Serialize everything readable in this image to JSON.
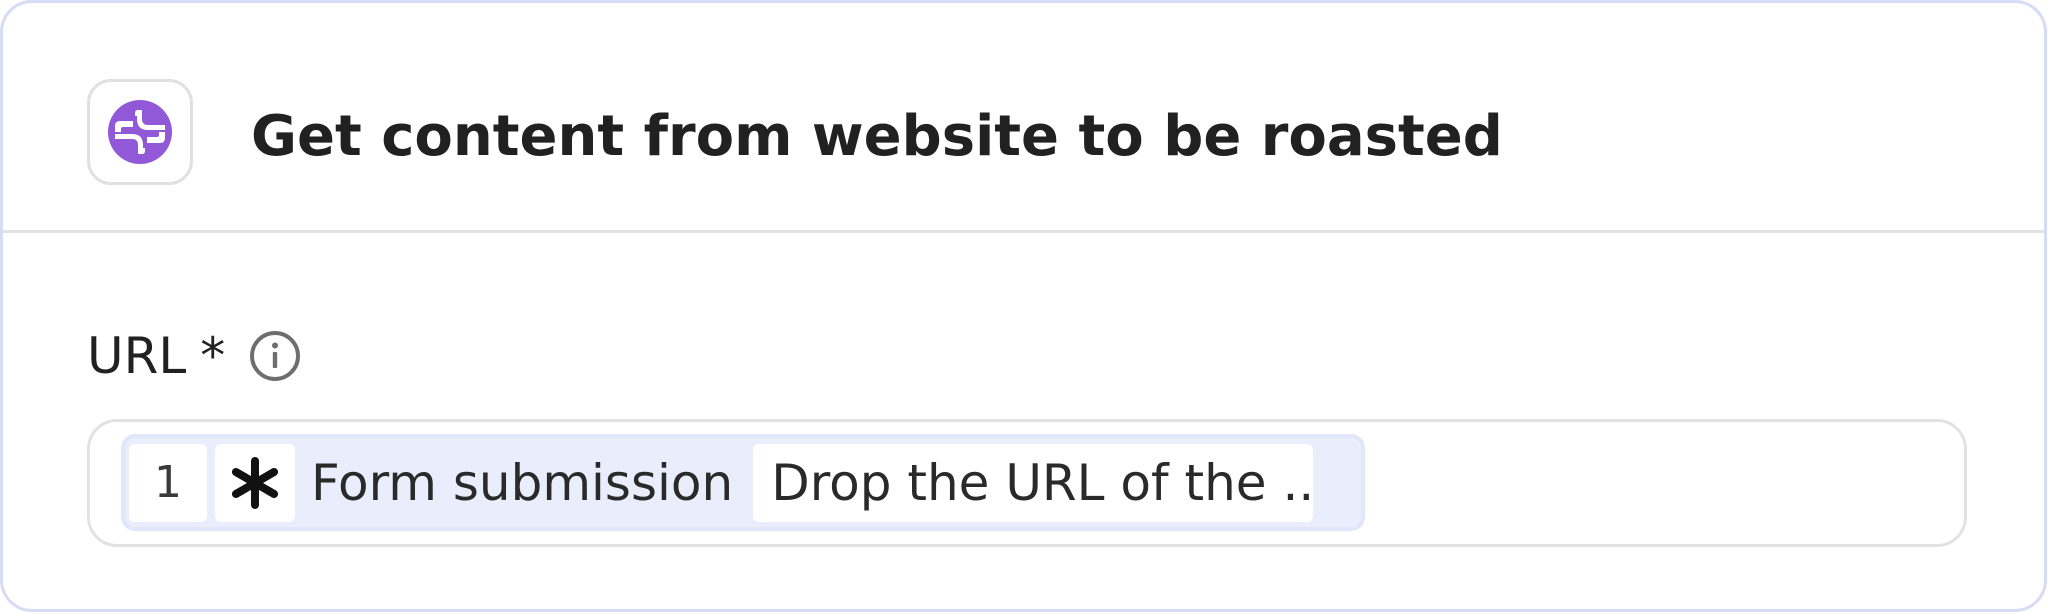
{
  "step": {
    "title": "Get content from website to be roasted",
    "app_icon": "purple-connector-logo-icon",
    "accent_color": "#9158d8"
  },
  "field": {
    "label": "URL",
    "required_mark": "*",
    "info_icon": "info-circle-icon"
  },
  "input": {
    "token": {
      "index": "1",
      "source_icon": "asterisk-form-icon",
      "source_label": "Form submission",
      "value": "Drop the URL of the ..."
    }
  },
  "colors": {
    "card_border": "#d6dbf6",
    "divider": "#e2e2e2",
    "token_background": "#eaedfc"
  }
}
